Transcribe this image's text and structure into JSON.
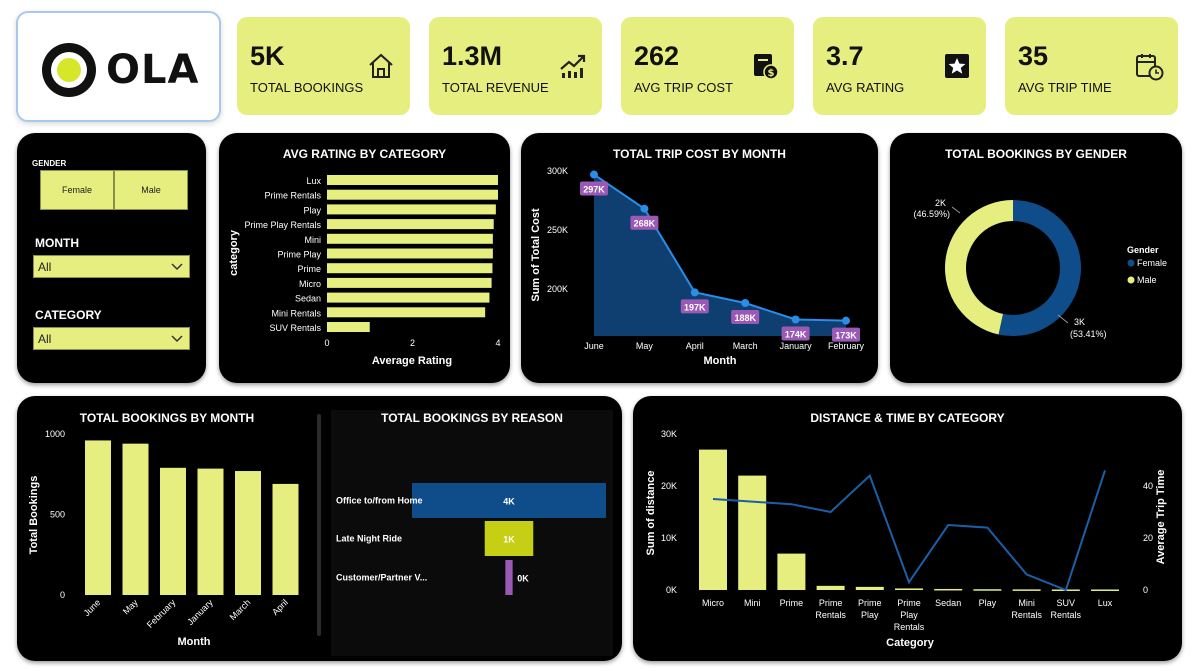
{
  "logo": {
    "text": "OLA"
  },
  "kpis": [
    {
      "value": "5K",
      "label": "TOTAL BOOKINGS",
      "icon": "home-icon"
    },
    {
      "value": "1.3M",
      "label": "TOTAL REVENUE",
      "icon": "trending-up-icon"
    },
    {
      "value": "262",
      "label": "AVG TRIP COST",
      "icon": "receipt-dollar-icon"
    },
    {
      "value": "3.7",
      "label": "AVG RATING",
      "icon": "star-box-icon"
    },
    {
      "value": "35",
      "label": "AVG TRIP TIME",
      "icon": "calendar-clock-icon"
    }
  ],
  "filters": {
    "gender_label": "GENDER",
    "gender_options": [
      "Female",
      "Male"
    ],
    "month_label": "MONTH",
    "month_value": "All",
    "category_label": "CATEGORY",
    "category_value": "All"
  },
  "colors": {
    "accent": "#e5ee7f",
    "navy": "#0f4c8a",
    "purple": "#9b59b6",
    "olive": "#c6cf14"
  },
  "charts": {
    "avg_rating": {
      "type": "bar",
      "title": "AVG RATING BY CATEGORY",
      "xlabel": "Average Rating",
      "ylabel": "category",
      "xticks": [
        "0",
        "2",
        "4"
      ],
      "xlim": [
        0,
        4
      ],
      "categories": [
        "Lux",
        "Prime Rentals",
        "Play",
        "Prime Play Rentals",
        "Mini",
        "Prime Play",
        "Prime",
        "Micro",
        "Sedan",
        "Mini Rentals",
        "SUV Rentals"
      ],
      "values": [
        4.0,
        4.0,
        3.95,
        3.9,
        3.88,
        3.88,
        3.87,
        3.85,
        3.8,
        3.7,
        1.0
      ]
    },
    "trip_cost": {
      "type": "area",
      "title": "TOTAL TRIP COST BY MONTH",
      "xlabel": "Month",
      "ylabel": "Sum of Total Cost",
      "yticks": [
        "300K",
        "250K",
        "200K"
      ],
      "categories": [
        "June",
        "May",
        "April",
        "March",
        "January",
        "February"
      ],
      "values": [
        297,
        268,
        197,
        188,
        174,
        173
      ],
      "labels": [
        "297K",
        "268K",
        "197K",
        "188K",
        "174K",
        "173K"
      ]
    },
    "gender": {
      "type": "pie",
      "title": "TOTAL BOOKINGS BY GENDER",
      "legend_title": "Gender",
      "slices": [
        {
          "name": "Female",
          "value": 53.41,
          "label": "3K",
          "pct": "(53.41%)",
          "color": "#0f4c8a"
        },
        {
          "name": "Male",
          "value": 46.59,
          "label": "2K",
          "pct": "(46.59%)",
          "color": "#e5ee7f"
        }
      ]
    },
    "bookings_month": {
      "type": "bar",
      "title": "TOTAL BOOKINGS BY MONTH",
      "xlabel": "Month",
      "ylabel": "Total Bookings",
      "yticks": [
        "1000",
        "500",
        "0"
      ],
      "categories": [
        "June",
        "May",
        "February",
        "January",
        "March",
        "April"
      ],
      "values": [
        960,
        940,
        790,
        785,
        770,
        690
      ]
    },
    "bookings_reason": {
      "type": "bar",
      "title": "TOTAL BOOKINGS BY REASON",
      "categories": [
        "Office to/from Home",
        "Late Night Ride",
        "Customer/Partner V..."
      ],
      "values": [
        4,
        1,
        0.15
      ],
      "labels": [
        "4K",
        "1K",
        "0K"
      ],
      "colors": [
        "#0f4c8a",
        "#c6cf14",
        "#9b59b6"
      ]
    },
    "distance_time": {
      "type": "bar",
      "title": "DISTANCE & TIME BY CATEGORY",
      "xlabel": "Category",
      "ylabel": "Sum of distance",
      "y2label": "Average Trip Time",
      "yticks": [
        "30K",
        "20K",
        "10K",
        "0K"
      ],
      "y2ticks": [
        "40",
        "20",
        "0"
      ],
      "categories": [
        [
          "Micro"
        ],
        [
          "Mini"
        ],
        [
          "Prime"
        ],
        [
          "Prime",
          "Rentals"
        ],
        [
          "Prime",
          "Play"
        ],
        [
          "Prime",
          "Play",
          "Rentals"
        ],
        [
          "Sedan"
        ],
        [
          "Play"
        ],
        [
          "Mini",
          "Rentals"
        ],
        [
          "SUV",
          "Rentals"
        ],
        [
          "Lux"
        ]
      ],
      "distance": [
        27000,
        22000,
        7000,
        800,
        600,
        300,
        200,
        150,
        120,
        100,
        100
      ],
      "trip_time": [
        35,
        34,
        33,
        30,
        44,
        3,
        25,
        24,
        6,
        0,
        46
      ]
    }
  }
}
